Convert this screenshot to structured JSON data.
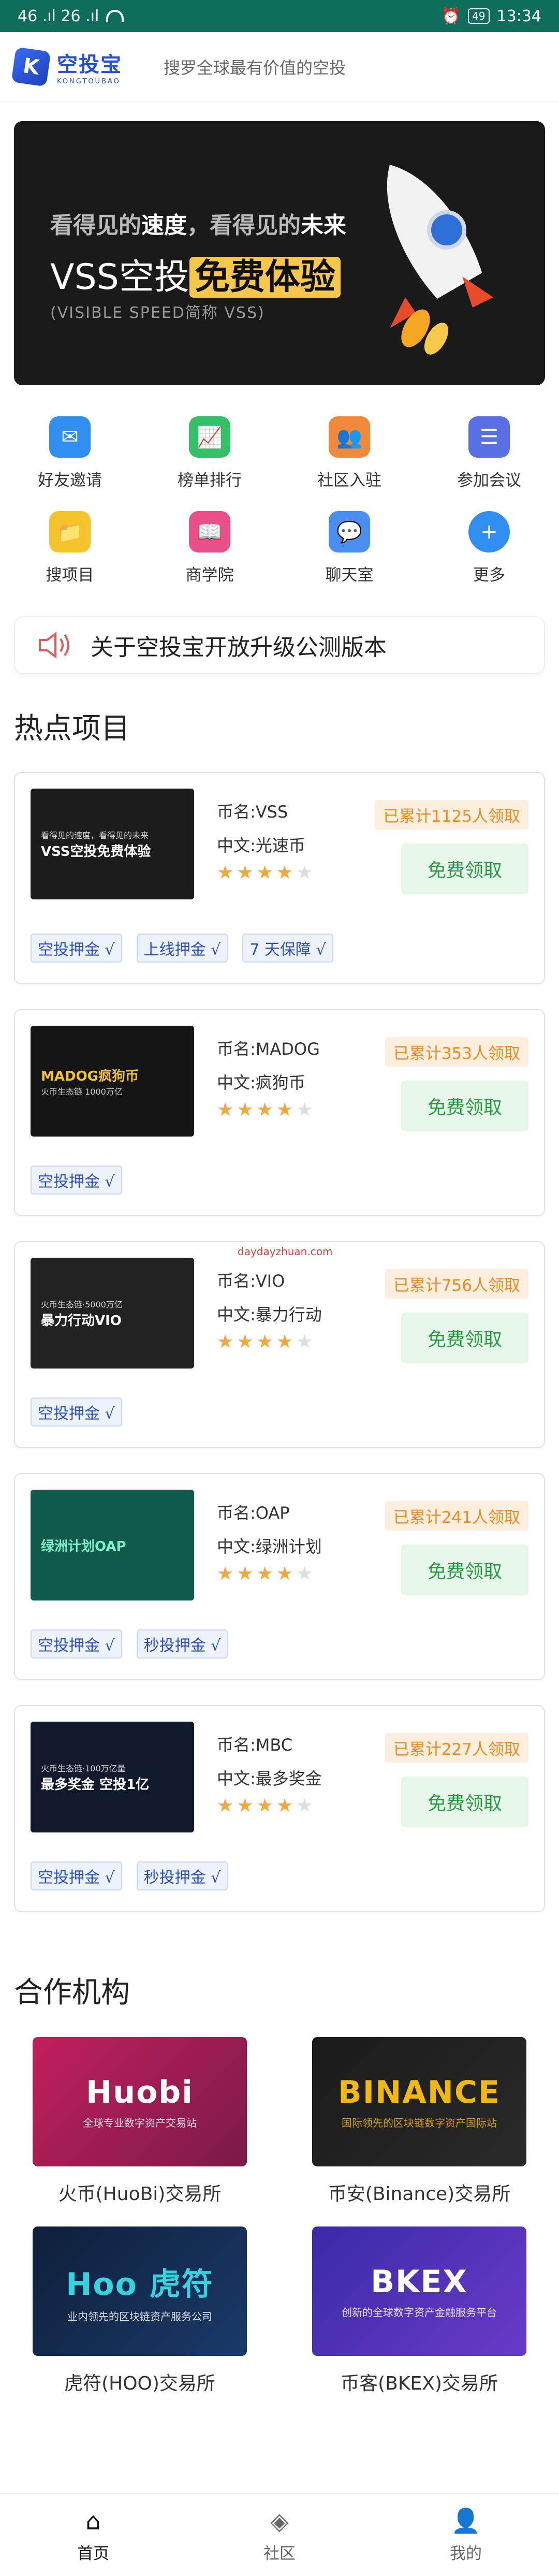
{
  "status_bar": {
    "carrier": "46 .ıl 26 .ıl",
    "time": "13:34",
    "battery": "49"
  },
  "header": {
    "logo_cn": "空投宝",
    "logo_en": "KONGTOUBAO",
    "logo_letter": "K",
    "slogan": "搜罗全球最有价值的空投"
  },
  "banner": {
    "line1_a": "看得见的",
    "line1_b": "速度",
    "line1_c": "，看得见的",
    "line1_d": "未来",
    "line2_a": "VSS空投",
    "line2_b": "免费体验",
    "line3": "(VISIBLE SPEED简称 VSS)"
  },
  "menu": [
    {
      "label": "好友邀请",
      "icon": "invite-icon",
      "color": "#2f8ef0"
    },
    {
      "label": "榜单排行",
      "icon": "chart-icon",
      "color": "#33c067"
    },
    {
      "label": "社区入驻",
      "icon": "community-icon",
      "color": "#f08a3a"
    },
    {
      "label": "参加会议",
      "icon": "meeting-icon",
      "color": "#5a6ee6"
    },
    {
      "label": "搜项目",
      "icon": "folder-icon",
      "color": "#f5c32b"
    },
    {
      "label": "商学院",
      "icon": "book-icon",
      "color": "#e8508a"
    },
    {
      "label": "聊天室",
      "icon": "chat-icon",
      "color": "#4a8ef0"
    },
    {
      "label": "更多",
      "icon": "plus-icon",
      "color": "#2f8ef0"
    }
  ],
  "notice": {
    "text": "关于空投宝开放升级公测版本",
    "icon": "speaker-icon"
  },
  "hot_title": "热点项目",
  "projects": [
    {
      "thumb_title": "VSS空投免费体验",
      "thumb_sub": "看得见的速度，看得见的未来",
      "thumb_bg": "#1c1c1c",
      "name": "币名:VSS",
      "cn": "中文:光速币",
      "rating": 4,
      "count": "已累计1125人领取",
      "claim": "免费领取",
      "tags": [
        "空投押金 √",
        "上线押金 √",
        "7 天保障 √"
      ]
    },
    {
      "thumb_title": "MADOG疯狗币",
      "thumb_sub": "火币生态链 1000万亿",
      "thumb_bg": "#151515",
      "name": "币名:MADOG",
      "cn": "中文:疯狗币",
      "rating": 4,
      "count": "已累计353人领取",
      "claim": "免费领取",
      "tags": [
        "空投押金 √"
      ]
    },
    {
      "thumb_title": "暴力行动VIO",
      "thumb_sub": "火币生态链·5000万亿",
      "thumb_bg": "#222",
      "name": "币名:VIO",
      "cn": "中文:暴力行动",
      "rating": 4,
      "count": "已累计756人领取",
      "claim": "免费领取",
      "tags": [
        "空投押金 √"
      ],
      "watermark": "daydayzhuan.com"
    },
    {
      "thumb_title": "绿洲计划OAP",
      "thumb_sub": "",
      "thumb_bg": "#0f5a4a",
      "name": "币名:OAP",
      "cn": "中文:绿洲计划",
      "rating": 4,
      "count": "已累计241人领取",
      "claim": "免费领取",
      "tags": [
        "空投押金 √",
        "秒投押金 √"
      ]
    },
    {
      "thumb_title": "最多奖金 空投1亿",
      "thumb_sub": "火币生态链·100万亿量",
      "thumb_bg": "#111a2c",
      "name": "币名:MBC",
      "cn": "中文:最多奖金",
      "rating": 4,
      "count": "已累计227人领取",
      "claim": "免费领取",
      "tags": [
        "空投押金 √",
        "秒投押金 √"
      ]
    }
  ],
  "partners_title": "合作机构",
  "partners": [
    {
      "brand": "Huobi",
      "sub": "全球专业数字资产交易站",
      "name": "火币(HuoBi)交易所",
      "bg": "linear-gradient(135deg,#c21f5b,#7a1a4a)"
    },
    {
      "brand": "BINANCE",
      "sub": "国际领先的区块链数字资产国际站",
      "name": "币安(Binance)交易所",
      "bg": "linear-gradient(135deg,#1a1a1a,#2a2a2a)"
    },
    {
      "brand": "Hoo 虎符",
      "sub": "业内领先的区块链资产服务公司",
      "name": "虎符(HOO)交易所",
      "bg": "linear-gradient(135deg,#0e1f3a,#1a3a6a)"
    },
    {
      "brand": "BKEX",
      "sub": "创新的全球数字资产金融服务平台",
      "name": "币客(BKEX)交易所",
      "bg": "linear-gradient(135deg,#3a2aa8,#6a3ac8)"
    }
  ],
  "bottom_nav": [
    {
      "label": "首页",
      "icon": "home-icon",
      "active": true
    },
    {
      "label": "社区",
      "icon": "community-nav-icon",
      "active": false
    },
    {
      "label": "我的",
      "icon": "profile-icon",
      "active": false
    }
  ]
}
